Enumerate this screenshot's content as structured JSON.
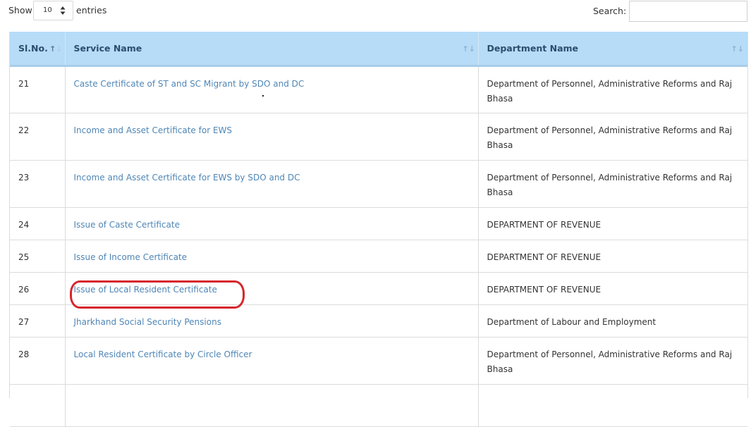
{
  "controls": {
    "show_label": "Show",
    "page_length": "10",
    "entries_label": "entries",
    "search_label": "Search:",
    "search_value": ""
  },
  "table": {
    "headers": {
      "sl_no": "Sl.No.",
      "service_name": "Service Name",
      "department_name": "Department Name"
    },
    "sort": {
      "column": "sl_no",
      "direction": "ascending"
    },
    "rows": [
      {
        "sl": "21",
        "service": "Caste Certificate of ST and SC Migrant by SDO and DC",
        "department": "Department of Personnel, Administrative Reforms and Raj Bhasa"
      },
      {
        "sl": "22",
        "service": "Income and Asset Certificate for EWS",
        "department": "Department of Personnel, Administrative Reforms and Raj Bhasa"
      },
      {
        "sl": "23",
        "service": "Income and Asset Certificate for EWS by SDO and DC",
        "department": "Department of Personnel, Administrative Reforms and Raj Bhasa"
      },
      {
        "sl": "24",
        "service": "Issue of Caste Certificate",
        "department": "DEPARTMENT OF REVENUE"
      },
      {
        "sl": "25",
        "service": "Issue of Income Certificate",
        "department": "DEPARTMENT OF REVENUE"
      },
      {
        "sl": "26",
        "service": "Issue of Local Resident Certificate",
        "department": "DEPARTMENT OF REVENUE"
      },
      {
        "sl": "27",
        "service": "Jharkhand Social Security Pensions",
        "department": "Department of Labour and Employment"
      },
      {
        "sl": "28",
        "service": "Local Resident Certificate by Circle Officer",
        "department": "Department of Personnel, Administrative Reforms and Raj Bhasa"
      },
      {
        "sl": "",
        "service": "",
        "department": ""
      }
    ]
  },
  "annotation": {
    "highlighted_row": "26",
    "color": "#d6262c"
  },
  "colors": {
    "header_bg": "#b6dcf8",
    "link": "#4f86b6"
  }
}
